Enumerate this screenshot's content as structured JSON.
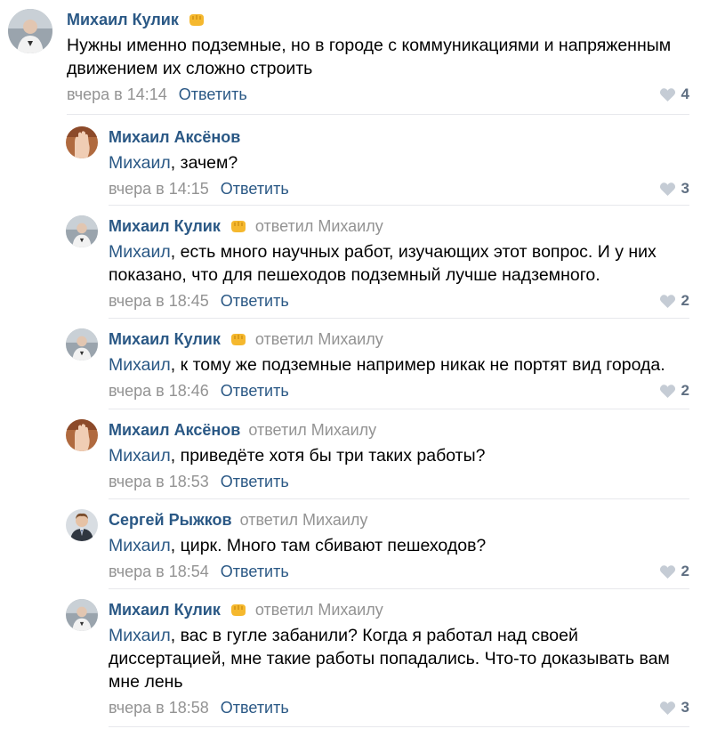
{
  "comments": [
    {
      "author": "Михаил Кулик",
      "badge": "fist-emoji",
      "replied_to": "",
      "mention": "",
      "text": "Нужны именно подземные, но в городе с коммуникациями и напряженным движением их сложно строить",
      "date": "вчера в 14:14",
      "reply_label": "Ответить",
      "likes": "4"
    },
    {
      "author": "Михаил Аксёнов",
      "badge": "",
      "replied_to": "",
      "mention": "Михаил",
      "text": ", зачем?",
      "date": "вчера в 14:15",
      "reply_label": "Ответить",
      "likes": "3"
    },
    {
      "author": "Михаил Кулик",
      "badge": "fist-emoji",
      "replied_to": "ответил Михаилу",
      "mention": "Михаил",
      "text": ", есть много научных работ, изучающих этот вопрос. И у них показано, что для пешеходов подземный лучше надземного.",
      "date": "вчера в 18:45",
      "reply_label": "Ответить",
      "likes": "2"
    },
    {
      "author": "Михаил Кулик",
      "badge": "fist-emoji",
      "replied_to": "ответил Михаилу",
      "mention": "Михаил",
      "text": ", к тому же подземные например никак не портят вид города.",
      "date": "вчера в 18:46",
      "reply_label": "Ответить",
      "likes": "2"
    },
    {
      "author": "Михаил Аксёнов",
      "badge": "",
      "replied_to": "ответил Михаилу",
      "mention": "Михаил",
      "text": ", приведёте хотя бы три таких работы?",
      "date": "вчера в 18:53",
      "reply_label": "Ответить",
      "likes": ""
    },
    {
      "author": "Сергей Рыжков",
      "badge": "",
      "replied_to": "ответил Михаилу",
      "mention": "Михаил",
      "text": ", цирк. Много там сбивают пешеходов?",
      "date": "вчера в 18:54",
      "reply_label": "Ответить",
      "likes": "2"
    },
    {
      "author": "Михаил Кулик",
      "badge": "fist-emoji",
      "replied_to": "ответил Михаилу",
      "mention": "Михаил",
      "text": ", вас в гугле забанили? Когда я работал над своей диссертацией, мне такие работы попадались. Что-то доказывать вам мне лень",
      "date": "вчера в 18:58",
      "reply_label": "Ответить",
      "likes": "3"
    }
  ],
  "colors": {
    "link": "#2a5885",
    "muted": "#939393",
    "divider": "#e7e8ec",
    "like": "#5f6f82",
    "heart": "#c5ccd5"
  }
}
